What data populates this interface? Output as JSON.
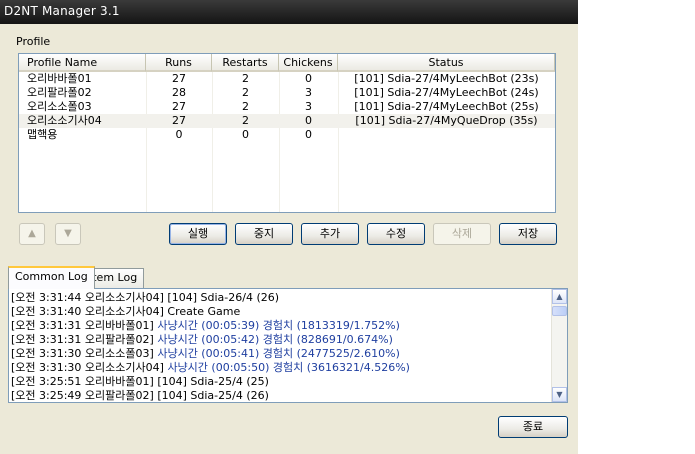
{
  "window": {
    "title": "D2NT Manager 3.1"
  },
  "profile": {
    "label": "Profile",
    "columns": [
      "Profile Name",
      "Runs",
      "Restarts",
      "Chickens",
      "Status"
    ],
    "rows": [
      {
        "name": "오리바바폴01",
        "runs": "27",
        "restarts": "2",
        "chickens": "0",
        "status": "[101] Sdia-27/4MyLeechBot (23s)"
      },
      {
        "name": "오리팔라폴02",
        "runs": "28",
        "restarts": "2",
        "chickens": "3",
        "status": "[101] Sdia-27/4MyLeechBot (24s)"
      },
      {
        "name": "오리소소폴03",
        "runs": "27",
        "restarts": "2",
        "chickens": "3",
        "status": "[101] Sdia-27/4MyLeechBot (25s)"
      },
      {
        "name": "오리소소기사04",
        "runs": "27",
        "restarts": "2",
        "chickens": "0",
        "status": "[101] Sdia-27/4MyQueDrop (35s)"
      },
      {
        "name": "맵핵용",
        "runs": "0",
        "restarts": "0",
        "chickens": "0",
        "status": ""
      }
    ]
  },
  "buttons": {
    "up_arrow": "▲",
    "down_arrow": "▼",
    "run": "실행",
    "stop": "중지",
    "add": "추가",
    "edit": "수정",
    "delete": "삭제",
    "save": "저장",
    "exit": "종료"
  },
  "tabs": {
    "common_log": "Common Log",
    "item_log": "Item Log"
  },
  "log": [
    {
      "text": "[오전 3:31:44 오리소소기사04] [104] Sdia-26/4 (26)",
      "hl": ""
    },
    {
      "text": "[오전 3:31:40 오리소소기사04] Create Game",
      "hl": ""
    },
    {
      "text": "[오전 3:31:31 오리바바폴01] ",
      "hl": "사냥시간 (00:05:39)  경험치 (1813319/1.752%)"
    },
    {
      "text": "[오전 3:31:31 오리팔라폴02] ",
      "hl": "사냥시간 (00:05:42)  경험치 (828691/0.674%)"
    },
    {
      "text": "[오전 3:31:30 오리소소폴03] ",
      "hl": "사냥시간 (00:05:41)  경험치 (2477525/2.610%)"
    },
    {
      "text": "[오전 3:31:30 오리소소기사04] ",
      "hl": "사냥시간 (00:05:50)  경험치 (3616321/4.526%)"
    },
    {
      "text": "[오전 3:25:51 오리바바폴01] [104] Sdia-25/4 (25)",
      "hl": ""
    },
    {
      "text": "[오전 3:25:49 오리팔라폴02] [104] Sdia-25/4 (26)",
      "hl": ""
    }
  ]
}
